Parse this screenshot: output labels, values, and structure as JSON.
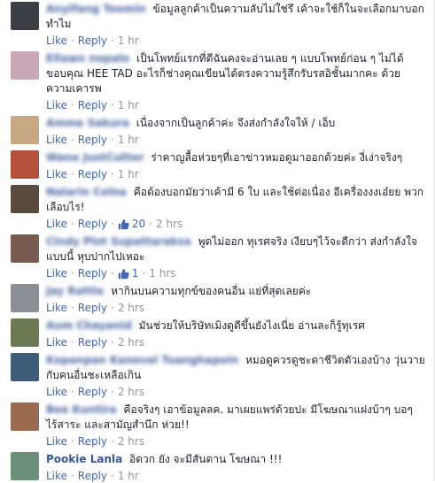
{
  "ui": {
    "like_label": "Like",
    "reply_label": "Reply",
    "separator": "·",
    "like_icon": "thumbs-up-icon"
  },
  "comments": [
    {
      "author": "Anyifang Toomin",
      "text": "ข้อมูลลูกค้าเป็นความลับไม่ใช่รึ เค้าจะใช้ก็ในจะเลือกมาบอกทำไม",
      "time": "1 hr",
      "avatar_color": "#3a3f45"
    },
    {
      "author": "Ellawn nopalo",
      "text": "เป็นโพทย์แรกที่ดีฉันคงจะอ่านเลย ๆ แบบโพทย์ก่อน ๆ ไม่ได้ ขอบคุณ HEE TAD อะไรก็ช่างคุณเขียนได้ตรงความรู้สึกรับรสอิชั้นมากคะ ด้วยความเคารพ",
      "time": "1 hr",
      "avatar_color": "#c9a7b7"
    },
    {
      "author": "Amme Sakura",
      "text": "เนื่องจากเป็นลูกค้าค่ะ จึงส่งกำลังใจให้ / เอ็บ",
      "time": "1 hr",
      "avatar_color": "#c8a882"
    },
    {
      "author": "Wane JustCutter",
      "text": "ร่าคาญลื้อห่วยๆที่เอาข่าวหมอดูมาออกด้วยค่ะ งี่เง่าจริงๆ",
      "time": "1 hr",
      "avatar_color": "#b5503a"
    },
    {
      "author": "Nalarin Colna",
      "text": "คือต้องบอกมัยว่าเค้ามี 6 ใบ และใช้ต่อเนื่อง อีเครื่องงงเอ๋ยย พวกเลือบไร!",
      "time": "2 hrs",
      "likes": "20",
      "avatar_color": "#5b4a3e"
    },
    {
      "author": "Cindy Plot Supattaraksa",
      "text": "พูดไม่ออก ทุเรศจริง เงียบๆไว้จะดีกว่า ส่งกำลังใจแบบนี้ หุบปากไปเหอะ",
      "time": "1 hrs",
      "likes": "1",
      "avatar_color": "#7a5b50"
    },
    {
      "author": "Jay Rattle",
      "text": "หากินบนความทุกข์ของคนอื่น แย่ที่สุดเลยค่ะ",
      "time": "2 hrs",
      "avatar_color": "#8a8f96"
    },
    {
      "author": "Aum Chayanid",
      "text": "มันช่วยให้บริษัทเมิงดูดีขึ้นยังไงเนี่ย อ่านละก็รู้ทุเรศ",
      "time": "2 hrs",
      "avatar_color": "#6b7a52"
    },
    {
      "author": "Kopanpan Kanoval Tuanghapoin",
      "text": "หมอดูควรดูชะตาชีวิตตัวเองบ้าง วุ่นวายกับคนอื่นชะเหลือเกิน",
      "time": "2 hrs",
      "avatar_color": "#3f5b7a"
    },
    {
      "author": "Bee Kuntira",
      "text": "คือจริงๆ เอาข้อมูลลค. มาเผยแพร่ด้วยปะ มีโฆษณาแฝงบ้าๆ บอๆ ไร้สาระ และสามัญสำนึก ห่วย!!",
      "time": "2 hrs",
      "avatar_color": "#9a6b4f"
    },
    {
      "author": "Pookie Lanla",
      "text": "อิดวก ยัง จะมีสันดาน โฆษณา !!!",
      "time": "1 hr",
      "avatar_color": "#6d8f7a"
    }
  ]
}
